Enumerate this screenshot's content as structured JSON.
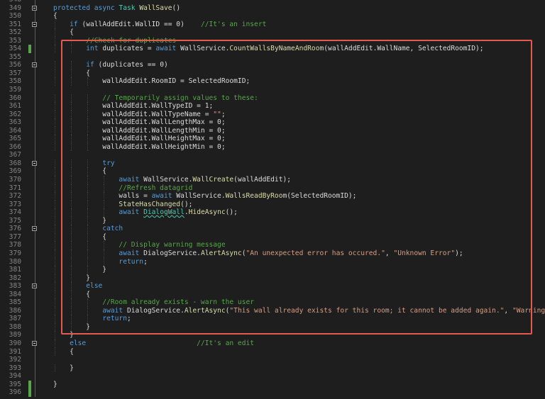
{
  "editor": {
    "lines": [
      {
        "num": "348",
        "fold": false,
        "mod": false,
        "tokens": []
      },
      {
        "num": "349",
        "fold": true,
        "mod": false,
        "tokens": [
          {
            "t": "protected",
            "c": "kw"
          },
          {
            "t": " ",
            "c": "pl"
          },
          {
            "t": "async",
            "c": "kw"
          },
          {
            "t": " ",
            "c": "pl"
          },
          {
            "t": "Task",
            "c": "ty"
          },
          {
            "t": " ",
            "c": "pl"
          },
          {
            "t": "WallSave",
            "c": "fn"
          },
          {
            "t": "()",
            "c": "pl"
          }
        ]
      },
      {
        "num": "350",
        "fold": false,
        "mod": false,
        "tokens": [
          {
            "t": "{",
            "c": "pl"
          }
        ]
      },
      {
        "num": "351",
        "fold": true,
        "mod": false,
        "tokens": [
          {
            "t": "    ",
            "c": "pl"
          },
          {
            "t": "if",
            "c": "kw"
          },
          {
            "t": " (wallAddEdit.WallID == 0)    ",
            "c": "pl"
          },
          {
            "t": "//It's an insert",
            "c": "cm"
          }
        ]
      },
      {
        "num": "352",
        "fold": false,
        "mod": false,
        "tokens": [
          {
            "t": "    {",
            "c": "pl"
          }
        ]
      },
      {
        "num": "353",
        "fold": false,
        "mod": false,
        "tokens": [
          {
            "t": "        ",
            "c": "pl"
          },
          {
            "t": "//Check for duplicates",
            "c": "cm"
          }
        ]
      },
      {
        "num": "354",
        "fold": false,
        "mod": true,
        "tokens": [
          {
            "t": "        ",
            "c": "pl"
          },
          {
            "t": "int",
            "c": "kw"
          },
          {
            "t": " duplicates = ",
            "c": "pl"
          },
          {
            "t": "await",
            "c": "kw"
          },
          {
            "t": " WallService.",
            "c": "pl"
          },
          {
            "t": "CountWallsByNameAndRoom",
            "c": "fn"
          },
          {
            "t": "(wallAddEdit.WallName, SelectedRoomID);",
            "c": "pl"
          }
        ]
      },
      {
        "num": "355",
        "fold": false,
        "mod": false,
        "tokens": []
      },
      {
        "num": "356",
        "fold": true,
        "mod": false,
        "tokens": [
          {
            "t": "        ",
            "c": "pl"
          },
          {
            "t": "if",
            "c": "kw"
          },
          {
            "t": " (duplicates == 0)",
            "c": "pl"
          }
        ]
      },
      {
        "num": "357",
        "fold": false,
        "mod": false,
        "tokens": [
          {
            "t": "        {",
            "c": "pl"
          }
        ]
      },
      {
        "num": "358",
        "fold": false,
        "mod": false,
        "tokens": [
          {
            "t": "            wallAddEdit.RoomID = SelectedRoomID;",
            "c": "pl"
          }
        ]
      },
      {
        "num": "359",
        "fold": false,
        "mod": false,
        "tokens": []
      },
      {
        "num": "360",
        "fold": false,
        "mod": false,
        "tokens": [
          {
            "t": "            ",
            "c": "pl"
          },
          {
            "t": "// Temporarily assign values to these:",
            "c": "cm"
          }
        ]
      },
      {
        "num": "361",
        "fold": false,
        "mod": false,
        "tokens": [
          {
            "t": "            wallAddEdit.WallTypeID = 1;",
            "c": "pl"
          }
        ]
      },
      {
        "num": "362",
        "fold": false,
        "mod": false,
        "tokens": [
          {
            "t": "            wallAddEdit.WallTypeName = ",
            "c": "pl"
          },
          {
            "t": "\"\"",
            "c": "str"
          },
          {
            "t": ";",
            "c": "pl"
          }
        ]
      },
      {
        "num": "363",
        "fold": false,
        "mod": false,
        "tokens": [
          {
            "t": "            wallAddEdit.WallLengthMax = 0;",
            "c": "pl"
          }
        ]
      },
      {
        "num": "364",
        "fold": false,
        "mod": false,
        "tokens": [
          {
            "t": "            wallAddEdit.WallLengthMin = 0;",
            "c": "pl"
          }
        ]
      },
      {
        "num": "365",
        "fold": false,
        "mod": false,
        "tokens": [
          {
            "t": "            wallAddEdit.WallHeightMax = 0;",
            "c": "pl"
          }
        ]
      },
      {
        "num": "366",
        "fold": false,
        "mod": false,
        "tokens": [
          {
            "t": "            wallAddEdit.WallHeightMin = 0;",
            "c": "pl"
          }
        ]
      },
      {
        "num": "367",
        "fold": false,
        "mod": false,
        "tokens": []
      },
      {
        "num": "368",
        "fold": true,
        "mod": false,
        "tokens": [
          {
            "t": "            ",
            "c": "pl"
          },
          {
            "t": "try",
            "c": "kw"
          }
        ]
      },
      {
        "num": "369",
        "fold": false,
        "mod": false,
        "tokens": [
          {
            "t": "            {",
            "c": "pl"
          }
        ]
      },
      {
        "num": "370",
        "fold": false,
        "mod": false,
        "tokens": [
          {
            "t": "                ",
            "c": "pl"
          },
          {
            "t": "await",
            "c": "kw"
          },
          {
            "t": " WallService.",
            "c": "pl"
          },
          {
            "t": "WallCreate",
            "c": "fn"
          },
          {
            "t": "(wallAddEdit);",
            "c": "pl"
          }
        ]
      },
      {
        "num": "371",
        "fold": false,
        "mod": false,
        "tokens": [
          {
            "t": "                ",
            "c": "pl"
          },
          {
            "t": "//Refresh datagrid",
            "c": "cm"
          }
        ]
      },
      {
        "num": "372",
        "fold": false,
        "mod": false,
        "tokens": [
          {
            "t": "                walls = ",
            "c": "pl"
          },
          {
            "t": "await",
            "c": "kw"
          },
          {
            "t": " WallService.",
            "c": "pl"
          },
          {
            "t": "WallsReadByRoom",
            "c": "fn"
          },
          {
            "t": "(SelectedRoomID);",
            "c": "pl"
          }
        ]
      },
      {
        "num": "373",
        "fold": false,
        "mod": false,
        "tokens": [
          {
            "t": "                ",
            "c": "pl"
          },
          {
            "t": "StateHasChanged",
            "c": "fn"
          },
          {
            "t": "();",
            "c": "pl"
          }
        ]
      },
      {
        "num": "374",
        "fold": false,
        "mod": false,
        "tokens": [
          {
            "t": "                ",
            "c": "pl"
          },
          {
            "t": "await",
            "c": "kw"
          },
          {
            "t": " ",
            "c": "pl"
          },
          {
            "t": "DialogWall",
            "c": "sq"
          },
          {
            "t": ".",
            "c": "pl"
          },
          {
            "t": "HideAsync",
            "c": "fn"
          },
          {
            "t": "();",
            "c": "pl"
          }
        ]
      },
      {
        "num": "375",
        "fold": false,
        "mod": false,
        "tokens": [
          {
            "t": "            }",
            "c": "pl"
          }
        ]
      },
      {
        "num": "376",
        "fold": true,
        "mod": false,
        "tokens": [
          {
            "t": "            ",
            "c": "pl"
          },
          {
            "t": "catch",
            "c": "kw"
          }
        ]
      },
      {
        "num": "377",
        "fold": false,
        "mod": false,
        "tokens": [
          {
            "t": "            {",
            "c": "pl"
          }
        ]
      },
      {
        "num": "378",
        "fold": false,
        "mod": false,
        "tokens": [
          {
            "t": "                ",
            "c": "pl"
          },
          {
            "t": "// Display warning message",
            "c": "cm"
          }
        ]
      },
      {
        "num": "379",
        "fold": false,
        "mod": false,
        "tokens": [
          {
            "t": "                ",
            "c": "pl"
          },
          {
            "t": "await",
            "c": "kw"
          },
          {
            "t": " DialogService.",
            "c": "pl"
          },
          {
            "t": "AlertAsync",
            "c": "fn"
          },
          {
            "t": "(",
            "c": "pl"
          },
          {
            "t": "\"An unexpected error has occured.\"",
            "c": "str"
          },
          {
            "t": ", ",
            "c": "pl"
          },
          {
            "t": "\"Unknown Error\"",
            "c": "str"
          },
          {
            "t": ");",
            "c": "pl"
          }
        ]
      },
      {
        "num": "380",
        "fold": false,
        "mod": false,
        "tokens": [
          {
            "t": "                ",
            "c": "pl"
          },
          {
            "t": "return",
            "c": "kw"
          },
          {
            "t": ";",
            "c": "pl"
          }
        ]
      },
      {
        "num": "381",
        "fold": false,
        "mod": false,
        "tokens": [
          {
            "t": "            }",
            "c": "pl"
          }
        ]
      },
      {
        "num": "382",
        "fold": false,
        "mod": false,
        "tokens": [
          {
            "t": "        }",
            "c": "pl"
          }
        ]
      },
      {
        "num": "383",
        "fold": true,
        "mod": false,
        "tokens": [
          {
            "t": "        ",
            "c": "pl"
          },
          {
            "t": "else",
            "c": "kw"
          }
        ]
      },
      {
        "num": "384",
        "fold": false,
        "mod": false,
        "tokens": [
          {
            "t": "        {",
            "c": "pl"
          }
        ]
      },
      {
        "num": "385",
        "fold": false,
        "mod": false,
        "tokens": [
          {
            "t": "            ",
            "c": "pl"
          },
          {
            "t": "//Room already exists - warn the user",
            "c": "cm"
          }
        ]
      },
      {
        "num": "386",
        "fold": false,
        "mod": false,
        "tokens": [
          {
            "t": "            ",
            "c": "pl"
          },
          {
            "t": "await",
            "c": "kw"
          },
          {
            "t": " DialogService.",
            "c": "pl"
          },
          {
            "t": "AlertAsync",
            "c": "fn"
          },
          {
            "t": "(",
            "c": "pl"
          },
          {
            "t": "\"This wall already exists for this room; it cannot be added again.\"",
            "c": "str"
          },
          {
            "t": ", ",
            "c": "pl"
          },
          {
            "t": "\"Warning!\"",
            "c": "str"
          },
          {
            "t": ");",
            "c": "pl"
          }
        ]
      },
      {
        "num": "387",
        "fold": false,
        "mod": false,
        "tokens": [
          {
            "t": "            ",
            "c": "pl"
          },
          {
            "t": "return",
            "c": "kw"
          },
          {
            "t": ";",
            "c": "pl"
          }
        ]
      },
      {
        "num": "388",
        "fold": false,
        "mod": false,
        "tokens": [
          {
            "t": "        }",
            "c": "pl"
          }
        ]
      },
      {
        "num": "389",
        "fold": false,
        "mod": false,
        "tokens": [
          {
            "t": "    }",
            "c": "pl"
          }
        ]
      },
      {
        "num": "390",
        "fold": true,
        "mod": false,
        "tokens": [
          {
            "t": "    ",
            "c": "pl"
          },
          {
            "t": "else",
            "c": "kw"
          },
          {
            "t": "                           ",
            "c": "pl"
          },
          {
            "t": "//It's an edit",
            "c": "cm"
          }
        ]
      },
      {
        "num": "391",
        "fold": false,
        "mod": false,
        "tokens": [
          {
            "t": "    {",
            "c": "pl"
          }
        ]
      },
      {
        "num": "392",
        "fold": false,
        "mod": false,
        "tokens": []
      },
      {
        "num": "393",
        "fold": false,
        "mod": false,
        "tokens": [
          {
            "t": "    }",
            "c": "pl"
          }
        ]
      },
      {
        "num": "394",
        "fold": false,
        "mod": false,
        "tokens": []
      },
      {
        "num": "395",
        "fold": false,
        "mod": true,
        "tokens": [
          {
            "t": "}",
            "c": "pl"
          }
        ]
      },
      {
        "num": "396",
        "fold": false,
        "mod": true,
        "tokens": []
      }
    ]
  },
  "colors": {
    "background": "#1e1e1e",
    "keyword": "#569cd6",
    "type": "#4ec9b0",
    "method": "#dcdcaa",
    "string": "#d69d85",
    "comment": "#57a64a",
    "text": "#dcdcdc",
    "line_number": "#858585",
    "modified_marker": "#57a64a",
    "highlight_border": "#e55a4f"
  }
}
